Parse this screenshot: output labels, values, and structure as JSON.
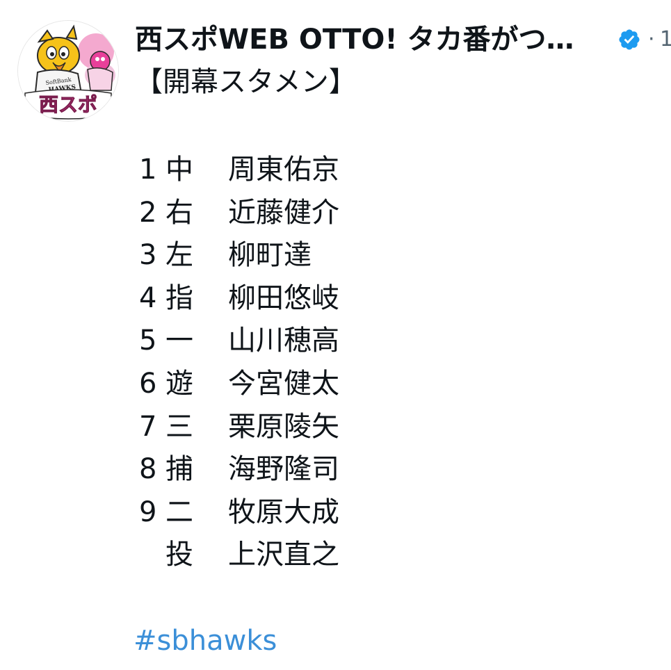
{
  "author": {
    "display_name": "西スポWEB OTTO! タカ番がつ…",
    "verified": true,
    "separator": "·",
    "trailing_text": "1",
    "avatar_text": "西スポ",
    "avatar_cap_text": "SoftBank HAWKS"
  },
  "tweet": {
    "title": "【開幕スタメン】",
    "lineup": [
      {
        "order": "1",
        "position": "中",
        "player": "周東佑京"
      },
      {
        "order": "2",
        "position": "右",
        "player": "近藤健介"
      },
      {
        "order": "3",
        "position": "左",
        "player": "柳町達"
      },
      {
        "order": "4",
        "position": "指",
        "player": "柳田悠岐"
      },
      {
        "order": "5",
        "position": "一",
        "player": "山川穂高"
      },
      {
        "order": "6",
        "position": "遊",
        "player": "今宮健太"
      },
      {
        "order": "7",
        "position": "三",
        "player": "栗原陵矢"
      },
      {
        "order": "8",
        "position": "捕",
        "player": "海野隆司"
      },
      {
        "order": "9",
        "position": "二",
        "player": "牧原大成"
      },
      {
        "order": "",
        "position": "投",
        "player": "上沢直之"
      }
    ],
    "hashtag": "#sbhawks"
  },
  "colors": {
    "text": "#0f1419",
    "link": "#3b8fd8",
    "verified_badge": "#1d9bf0",
    "avatar_pink": "#e8409a",
    "avatar_yellow": "#f6c21a"
  }
}
